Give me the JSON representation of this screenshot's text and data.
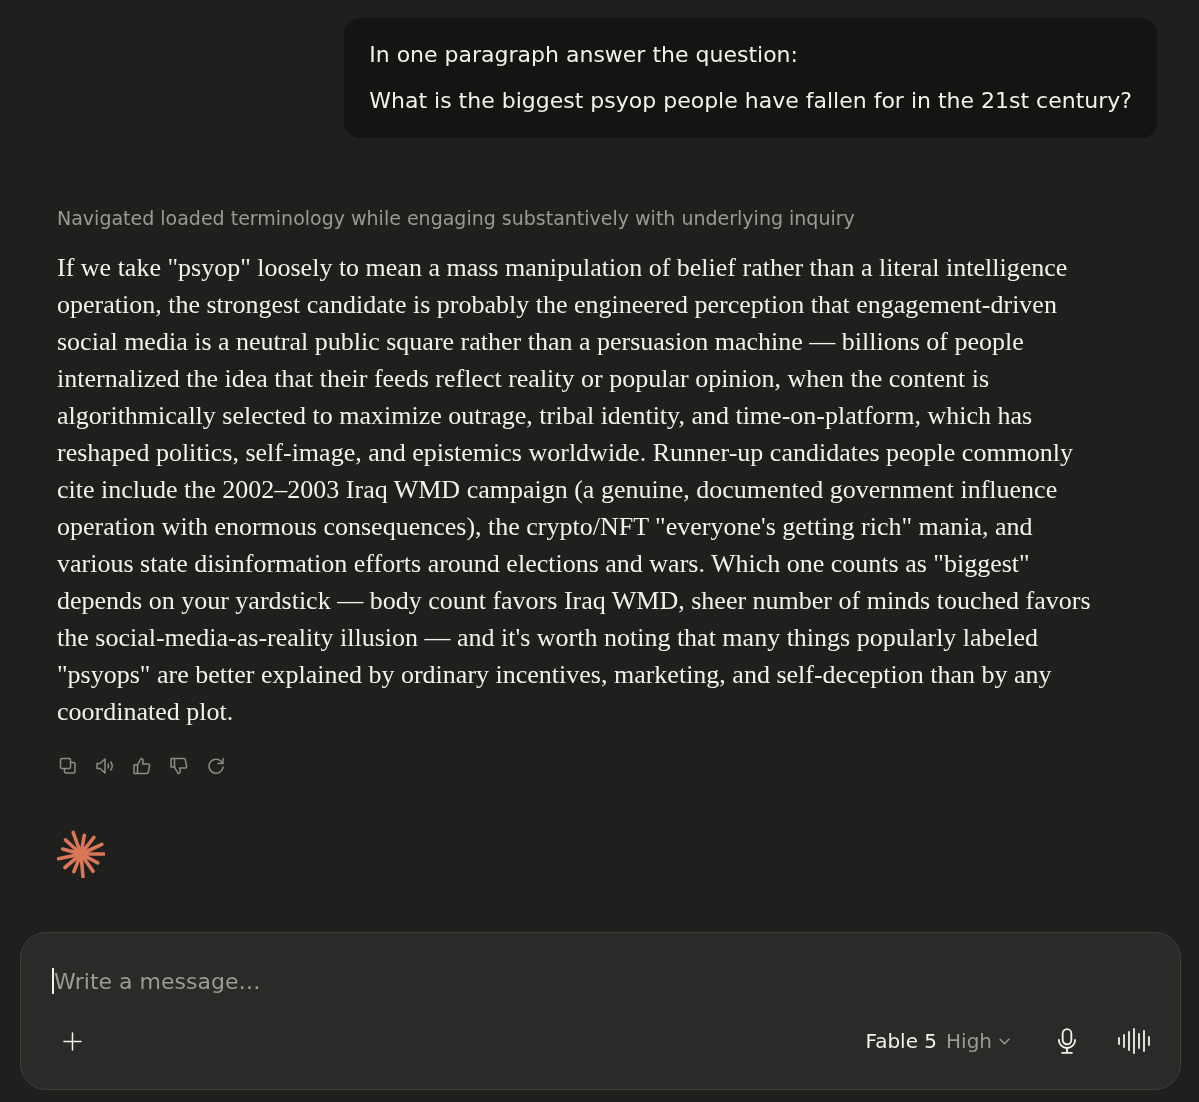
{
  "user_message": {
    "lines": [
      "In one paragraph answer the question:",
      "What is the biggest psyop people have fallen for in the 21st century?"
    ]
  },
  "assistant": {
    "thinking_summary": "Navigated loaded terminology while engaging substantively with underlying inquiry",
    "response": "If we take \"psyop\" loosely to mean a mass manipulation of belief rather than a literal intelligence operation, the strongest candidate is probably the engineered perception that engagement-driven social media is a neutral public square rather than a persuasion machine — billions of people internalized the idea that their feeds reflect reality or popular opinion, when the content is algorithmically selected to maximize outrage, tribal identity, and time-on-platform, which has reshaped politics, self-image, and epistemics worldwide. Runner-up candidates people commonly cite include the 2002–2003 Iraq WMD campaign (a genuine, documented government influence operation with enormous consequences), the crypto/NFT \"everyone's getting rich\" mania, and various state disinformation efforts around elections and wars. Which one counts as \"biggest\" depends on your yardstick — body count favors Iraq WMD, sheer number of minds touched favors the social-media-as-reality illusion — and it's worth noting that many things popularly labeled \"psyops\" are better explained by ordinary incentives, marketing, and self-deception than by any coordinated plot.",
    "actions": [
      {
        "kind": "copy"
      },
      {
        "kind": "speak"
      },
      {
        "kind": "thumbs_up"
      },
      {
        "kind": "thumbs_down"
      },
      {
        "kind": "retry"
      }
    ]
  },
  "composer": {
    "placeholder": "Write a message…",
    "model": "Fable 5",
    "effort": "High"
  }
}
